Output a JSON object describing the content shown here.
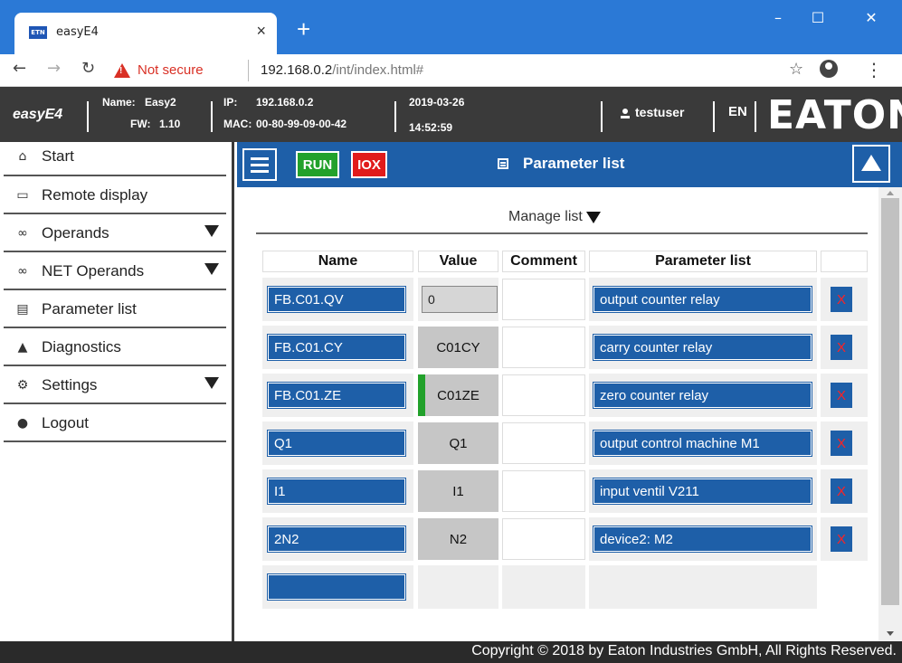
{
  "browser": {
    "tab_title": "easyE4",
    "favicon_text": "ETN",
    "tab_close": "×",
    "new_tab": "+",
    "security_label": "Not secure",
    "url_host": "192.168.0.2",
    "url_path": "/int/index.html#"
  },
  "header": {
    "brand": "easyE4",
    "name_label": "Name:",
    "name_value": "Easy2",
    "fw_label": "FW:",
    "fw_value": "1.10",
    "ip_label": "IP:",
    "ip_value": "192.168.0.2",
    "mac_label": "MAC:",
    "mac_value": "00-80-99-09-00-42",
    "date": "2019-03-26",
    "time": "14:52:59",
    "user": "testuser",
    "lang": "EN",
    "logo": "EATON"
  },
  "sidebar": {
    "items": [
      {
        "label": "Start",
        "icon": "home-icon"
      },
      {
        "label": "Remote display",
        "icon": "monitor-icon"
      },
      {
        "label": "Operands",
        "icon": "glasses-icon"
      },
      {
        "label": "NET Operands",
        "icon": "glasses-icon"
      },
      {
        "label": "Parameter list",
        "icon": "list-icon"
      },
      {
        "label": "Diagnostics",
        "icon": "warning-icon"
      },
      {
        "label": "Settings",
        "icon": "gear-icon"
      },
      {
        "label": "Logout",
        "icon": "user-icon"
      }
    ]
  },
  "toolbar": {
    "run_label": "RUN",
    "iox_label": "IOX",
    "page_title": "Parameter list"
  },
  "manage": {
    "label": "Manage list"
  },
  "table": {
    "headers": {
      "name": "Name",
      "value": "Value",
      "comment": "Comment",
      "parameter_list": "Parameter list"
    },
    "delete_label": "X",
    "rows": [
      {
        "name": "FB.C01.QV",
        "value": "0",
        "comment": "",
        "parameter": "output counter relay"
      },
      {
        "name": "FB.C01.CY",
        "value": "C01CY",
        "comment": "",
        "parameter": "carry counter relay"
      },
      {
        "name": "FB.C01.ZE",
        "value": "C01ZE",
        "comment": "",
        "parameter": "zero counter relay"
      },
      {
        "name": "Q1",
        "value": "Q1",
        "comment": "",
        "parameter": "output control machine M1"
      },
      {
        "name": "I1",
        "value": "I1",
        "comment": "",
        "parameter": "input ventil V211"
      },
      {
        "name": "2N2",
        "value": "N2",
        "comment": "",
        "parameter": "device2: M2"
      },
      {
        "name": "",
        "value": "",
        "comment": "",
        "parameter": ""
      }
    ]
  },
  "footer": {
    "copyright": "Copyright © 2018 by Eaton Industries GmbH, All Rights Reserved."
  },
  "colors": {
    "primary_blue": "#1e5fa8",
    "run_green": "#22a12b",
    "iox_red": "#e11b1b",
    "header_dark": "#3a3a3a",
    "chrome_blue": "#2b79d6"
  }
}
